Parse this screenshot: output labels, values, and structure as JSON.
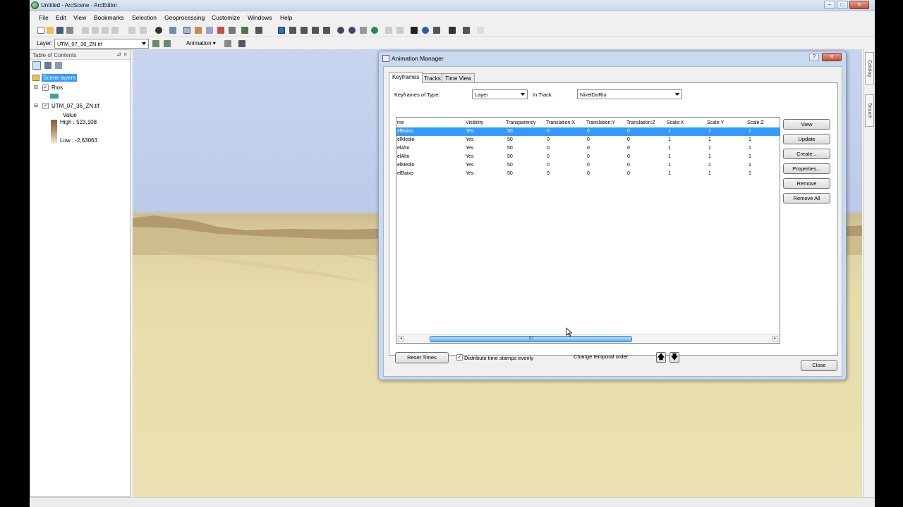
{
  "app": {
    "title": "Untitled - ArcScene - ArcEditor",
    "window_buttons": [
      "–",
      "□",
      "✕"
    ]
  },
  "menu": [
    "File",
    "Edit",
    "View",
    "Bookmarks",
    "Selection",
    "Geoprocessing",
    "Customize",
    "Windows",
    "Help"
  ],
  "layer_toolbar": {
    "layer_label": "Layer:",
    "layer_value": "UTM_07_36_ZN.tif",
    "animation_label": "Animation ▾"
  },
  "toc": {
    "title": "Table of Contents",
    "root": "Scene layers",
    "layers": [
      {
        "name": "Rios",
        "checked": true,
        "swatch": "#3aa49a"
      },
      {
        "name": "UTM_07_36_ZN.tif",
        "checked": true
      }
    ],
    "legend": {
      "heading": "Value",
      "high": "High : 523,108",
      "low": "Low : -2,63063"
    }
  },
  "side_tabs": [
    "Catalog",
    "Search"
  ],
  "dialog": {
    "title": "Animation Manager",
    "tabs": [
      "Keyframes",
      "Tracks",
      "Time View"
    ],
    "type_label": "Keyframes of Type:",
    "type_value": "Layer",
    "track_label": "In Track:",
    "track_value": "NivelDoRio",
    "columns": [
      "me",
      "Visibility",
      "Transparency",
      "Translation:X",
      "Translation:Y",
      "Translation:Z",
      "Scale:X",
      "Scale:Y",
      "Scale:Z"
    ],
    "rows": [
      [
        "elBaixo",
        "Yes",
        "50",
        "0",
        "0",
        "0",
        "1",
        "1",
        "1"
      ],
      [
        "elMedio",
        "Yes",
        "50",
        "0",
        "0",
        "0",
        "1",
        "1",
        "1"
      ],
      [
        "elAlto",
        "Yes",
        "50",
        "0",
        "0",
        "0",
        "1",
        "1",
        "1"
      ],
      [
        "elAlto",
        "Yes",
        "50",
        "0",
        "0",
        "0",
        "1",
        "1",
        "1"
      ],
      [
        "elMedio",
        "Yes",
        "50",
        "0",
        "0",
        "0",
        "1",
        "1",
        "1"
      ],
      [
        "elBaixo",
        "Yes",
        "50",
        "0",
        "0",
        "0",
        "1",
        "1",
        "1"
      ]
    ],
    "selected_row": 0,
    "side_buttons": [
      "View",
      "Update",
      "Create...",
      "Properties...",
      "Remove",
      "Remove All"
    ],
    "reset_button": "Reset Times",
    "distribute_label": "Distribute time stamps evenly",
    "distribute_checked": "✓",
    "temporal_label": "Change temporal order:",
    "up_arrow": "🡅",
    "down_arrow": "🡇",
    "close_button": "Close",
    "scroll_grip": "III"
  },
  "colors": {
    "selection": "#3399ff",
    "sky": "#c7d5ef",
    "terrain": "#e7dcaa"
  }
}
